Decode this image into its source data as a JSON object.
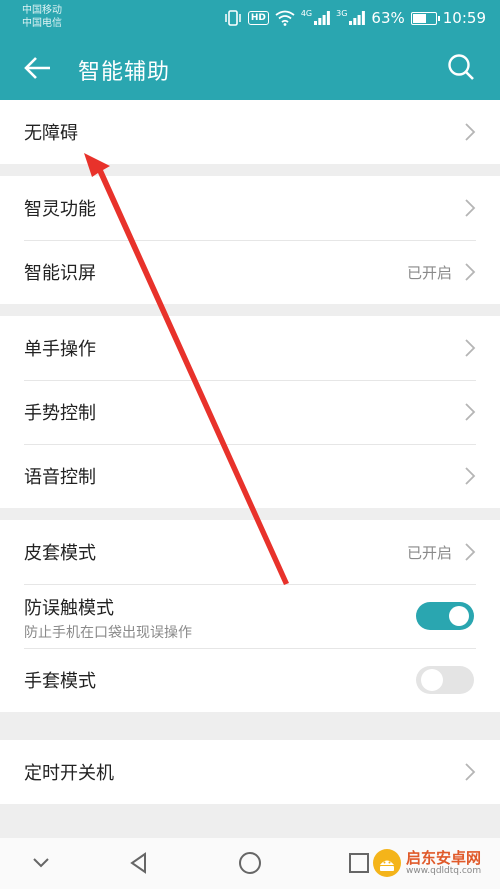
{
  "status_bar": {
    "carrier_1": "中国移动",
    "carrier_2": "中国电信",
    "hd_label": "HD",
    "network_1": "4G",
    "network_2": "3G",
    "battery_percent": "63%",
    "battery_level": 0.63,
    "time": "10:59"
  },
  "header": {
    "title": "智能辅助",
    "background_color": "#2aa6b0"
  },
  "groups": [
    {
      "items": [
        {
          "label": "无障碍",
          "status": "",
          "control": "chevron"
        }
      ]
    },
    {
      "items": [
        {
          "label": "智灵功能",
          "status": "",
          "control": "chevron"
        },
        {
          "label": "智能识屏",
          "status": "已开启",
          "control": "chevron"
        }
      ]
    },
    {
      "items": [
        {
          "label": "单手操作",
          "status": "",
          "control": "chevron"
        },
        {
          "label": "手势控制",
          "status": "",
          "control": "chevron"
        },
        {
          "label": "语音控制",
          "status": "",
          "control": "chevron"
        }
      ]
    },
    {
      "items": [
        {
          "label": "皮套模式",
          "status": "已开启",
          "control": "chevron"
        },
        {
          "label": "防误触模式",
          "subtitle": "防止手机在口袋出现误操作",
          "control": "toggle",
          "enabled": true
        },
        {
          "label": "手套模式",
          "control": "toggle",
          "enabled": false
        }
      ]
    },
    {
      "items": [
        {
          "label": "定时开关机",
          "status": "",
          "control": "chevron"
        }
      ]
    }
  ],
  "icons": {
    "back": "arrow-left-icon",
    "search": "search-icon",
    "chevron": "chevron-right-icon",
    "nav_hide": "chevron-down-icon",
    "nav_back": "triangle-back-icon",
    "nav_home": "circle-home-icon",
    "nav_recent": "square-recent-icon"
  },
  "watermark": {
    "main": "启东安卓网",
    "sub": "www.qdldtq.com"
  },
  "annotation_color": "#e8322b"
}
